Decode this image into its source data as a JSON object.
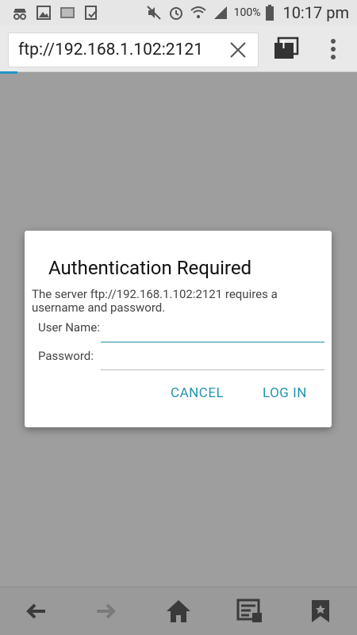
{
  "status_bar": {
    "battery_percent": "100%",
    "time": "10:17 pm"
  },
  "toolbar": {
    "url": "ftp://192.168.1.102:2121",
    "tab_count": "1"
  },
  "dialog": {
    "title": "Authentication Required",
    "message": "The server ftp://192.168.1.102:2121  requires a username and password.",
    "username_label": "User Name:",
    "password_label": "Password:",
    "username_value": "",
    "password_value": "",
    "cancel_label": "CANCEL",
    "login_label": "LOG IN"
  },
  "colors": {
    "accent": "#2593b1",
    "focus_underline": "#1c8fa4",
    "scrim": "#9e9e9e"
  },
  "icons": {
    "status_left": [
      "incognito-icon",
      "gallery-icon",
      "photo-icon",
      "task-icon"
    ],
    "status_right": [
      "mute-icon",
      "alarm-icon",
      "wifi-icon",
      "signal-icon",
      "battery-icon"
    ],
    "bottom_nav": [
      "back-arrow-icon",
      "forward-arrow-icon",
      "home-icon",
      "reader-icon",
      "bookmark-icon"
    ]
  }
}
